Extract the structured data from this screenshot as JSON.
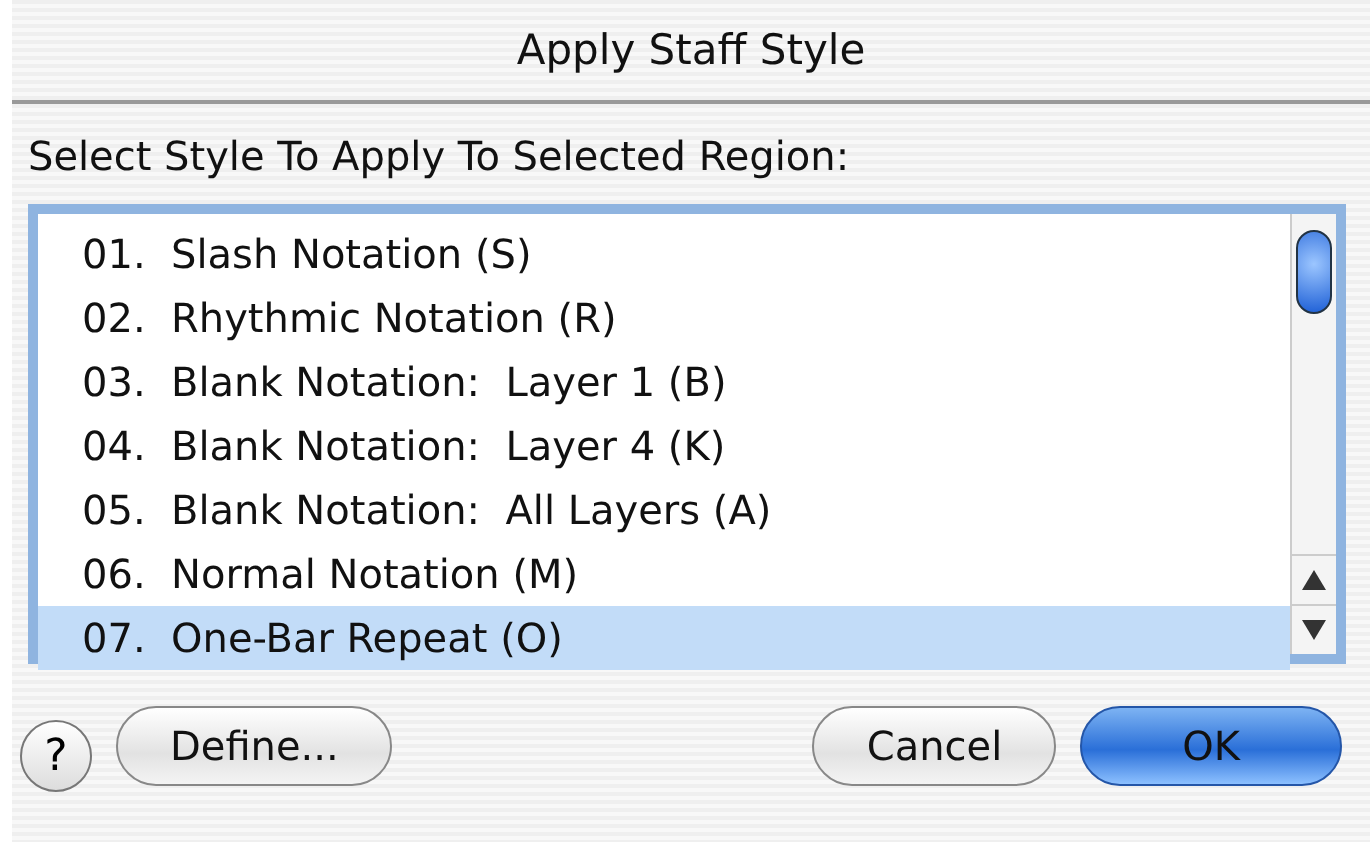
{
  "window": {
    "title": "Apply Staff Style"
  },
  "prompt": "Select Style To Apply To Selected Region:",
  "styles": [
    {
      "label": "01.  Slash Notation (S)",
      "selected": false
    },
    {
      "label": "02.  Rhythmic Notation (R)",
      "selected": false
    },
    {
      "label": "03.  Blank Notation:  Layer 1 (B)",
      "selected": false
    },
    {
      "label": "04.  Blank Notation:  Layer 4 (K)",
      "selected": false
    },
    {
      "label": "05.  Blank Notation:  All Layers (A)",
      "selected": false
    },
    {
      "label": "06.  Normal Notation (M)",
      "selected": false
    },
    {
      "label": "07.  One-Bar Repeat (O)",
      "selected": true
    }
  ],
  "help": "?",
  "buttons": [
    {
      "label": "Define...",
      "kind": "normal"
    },
    {
      "label": "Cancel",
      "kind": "normal"
    },
    {
      "label": "OK",
      "kind": "default"
    }
  ]
}
